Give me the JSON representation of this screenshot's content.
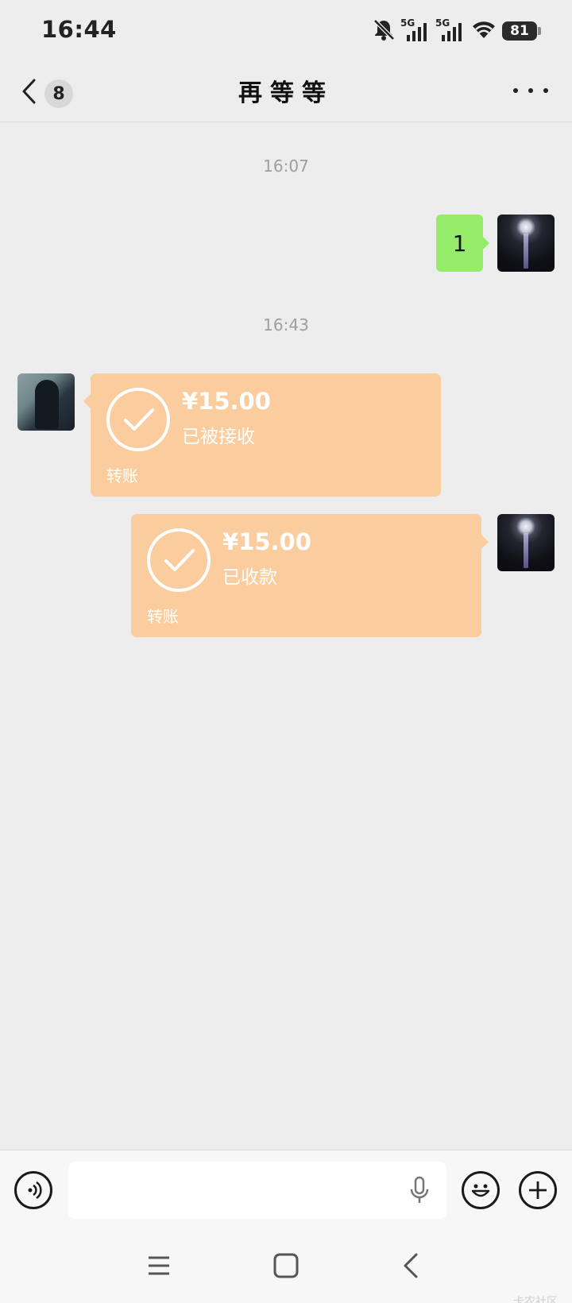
{
  "status_bar": {
    "time": "16:44",
    "network_1": "5G",
    "network_2": "5G",
    "battery": "81",
    "icons": [
      "bell-muted-icon",
      "signal-icon",
      "signal-icon",
      "wifi-icon",
      "battery-icon"
    ]
  },
  "header": {
    "back_badge": "8",
    "title": "再等等",
    "icons": [
      "chevron-left-icon",
      "more-icon"
    ]
  },
  "messages": {
    "timestamp_1": "16:07",
    "text_1": "1",
    "timestamp_2": "16:43",
    "transfer_1": {
      "amount": "¥15.00",
      "status": "已被接收",
      "type": "转账"
    },
    "transfer_2": {
      "amount": "¥15.00",
      "status": "已收款",
      "type": "转账"
    }
  },
  "input_bar": {
    "value": "",
    "icons": [
      "voice-icon",
      "microphone-icon",
      "emoji-icon",
      "plus-icon"
    ]
  },
  "nav_bar": {
    "icons": [
      "menu-icon",
      "home-icon",
      "back-icon"
    ]
  },
  "watermark": "卡农社区",
  "colors": {
    "background": "#ededed",
    "text_bubble": "#95ec69",
    "transfer_bubble": "#fbcd9e"
  }
}
